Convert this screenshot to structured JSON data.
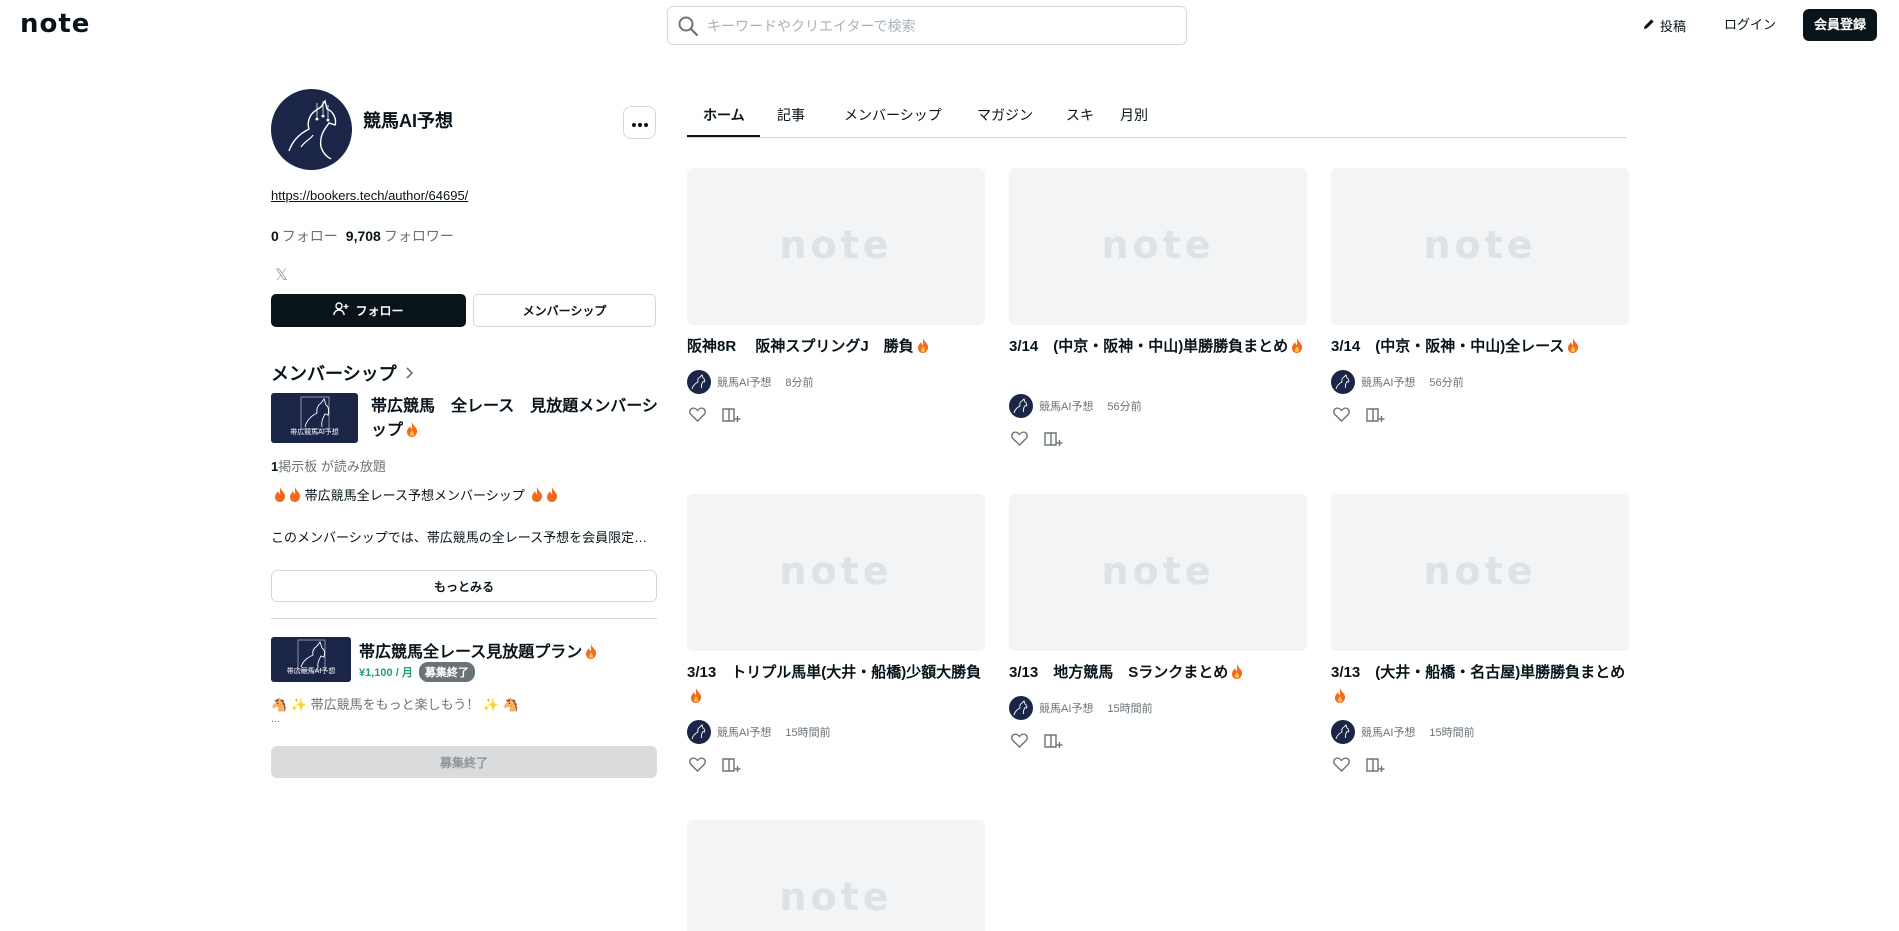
{
  "header": {
    "logo": "note",
    "search_placeholder": "キーワードやクリエイターで検索",
    "post_label": "投稿",
    "login_label": "ログイン",
    "signup_label": "会員登録"
  },
  "profile": {
    "name": "競馬AI予想",
    "link": "https://bookers.tech/author/64695/",
    "follow_count": "0",
    "follow_label": "フォロー",
    "follower_count": "9,708",
    "follower_label": "フォロワー",
    "x_icon": "𝕏",
    "follow_button": "フォロー",
    "membership_button": "メンバーシップ"
  },
  "membership": {
    "heading": "メンバーシップ",
    "thumb_text": "帯広競馬AI予想",
    "title": "帯広競馬　全レース　見放題メンバーシップ",
    "boards_count": "1",
    "boards_label": "掲示板 が読み放題",
    "desc1": "帯広競馬全レース予想メンバーシップ",
    "desc2": "このメンバーシップでは、帯広競馬の全レース予想を会員限定で公開しています。",
    "more_button": "もっとみる",
    "plan_title": "帯広競馬全レース見放題プラン",
    "plan_price": "¥1,100 / 月",
    "plan_badge": "募集終了",
    "plan_desc": "帯広競馬をもっと楽しもう！",
    "plan_ellipsis": "...",
    "closed_button": "募集終了"
  },
  "tabs": [
    {
      "label": "ホーム"
    },
    {
      "label": "記事"
    },
    {
      "label": "メンバーシップ"
    },
    {
      "label": "マガジン"
    },
    {
      "label": "スキ"
    },
    {
      "label": "月別"
    }
  ],
  "articles": [
    {
      "title": "阪神8R　 阪神スプリングJ　勝負",
      "author": "競馬AI予想",
      "time": "8分前"
    },
    {
      "title": "3/14　(中京・阪神・中山)単勝勝負まとめ",
      "author": "競馬AI予想",
      "time": "56分前"
    },
    {
      "title": "3/14　(中京・阪神・中山)全レース",
      "author": "競馬AI予想",
      "time": "56分前"
    },
    {
      "title": "3/13　トリプル馬単(大井・船橋)少額大勝負",
      "author": "競馬AI予想",
      "time": "15時間前"
    },
    {
      "title": "3/13　地方競馬　Sランクまとめ",
      "author": "競馬AI予想",
      "time": "15時間前"
    },
    {
      "title": "3/13　(大井・船橋・名古屋)単勝勝負まとめ",
      "author": "競馬AI予想",
      "time": "15時間前"
    }
  ],
  "thumb_logo": "note",
  "colors": {
    "text": "#08131a",
    "accent_green": "#1f9f7b",
    "navy": "#1a2547",
    "fire": "#f26b1d"
  }
}
